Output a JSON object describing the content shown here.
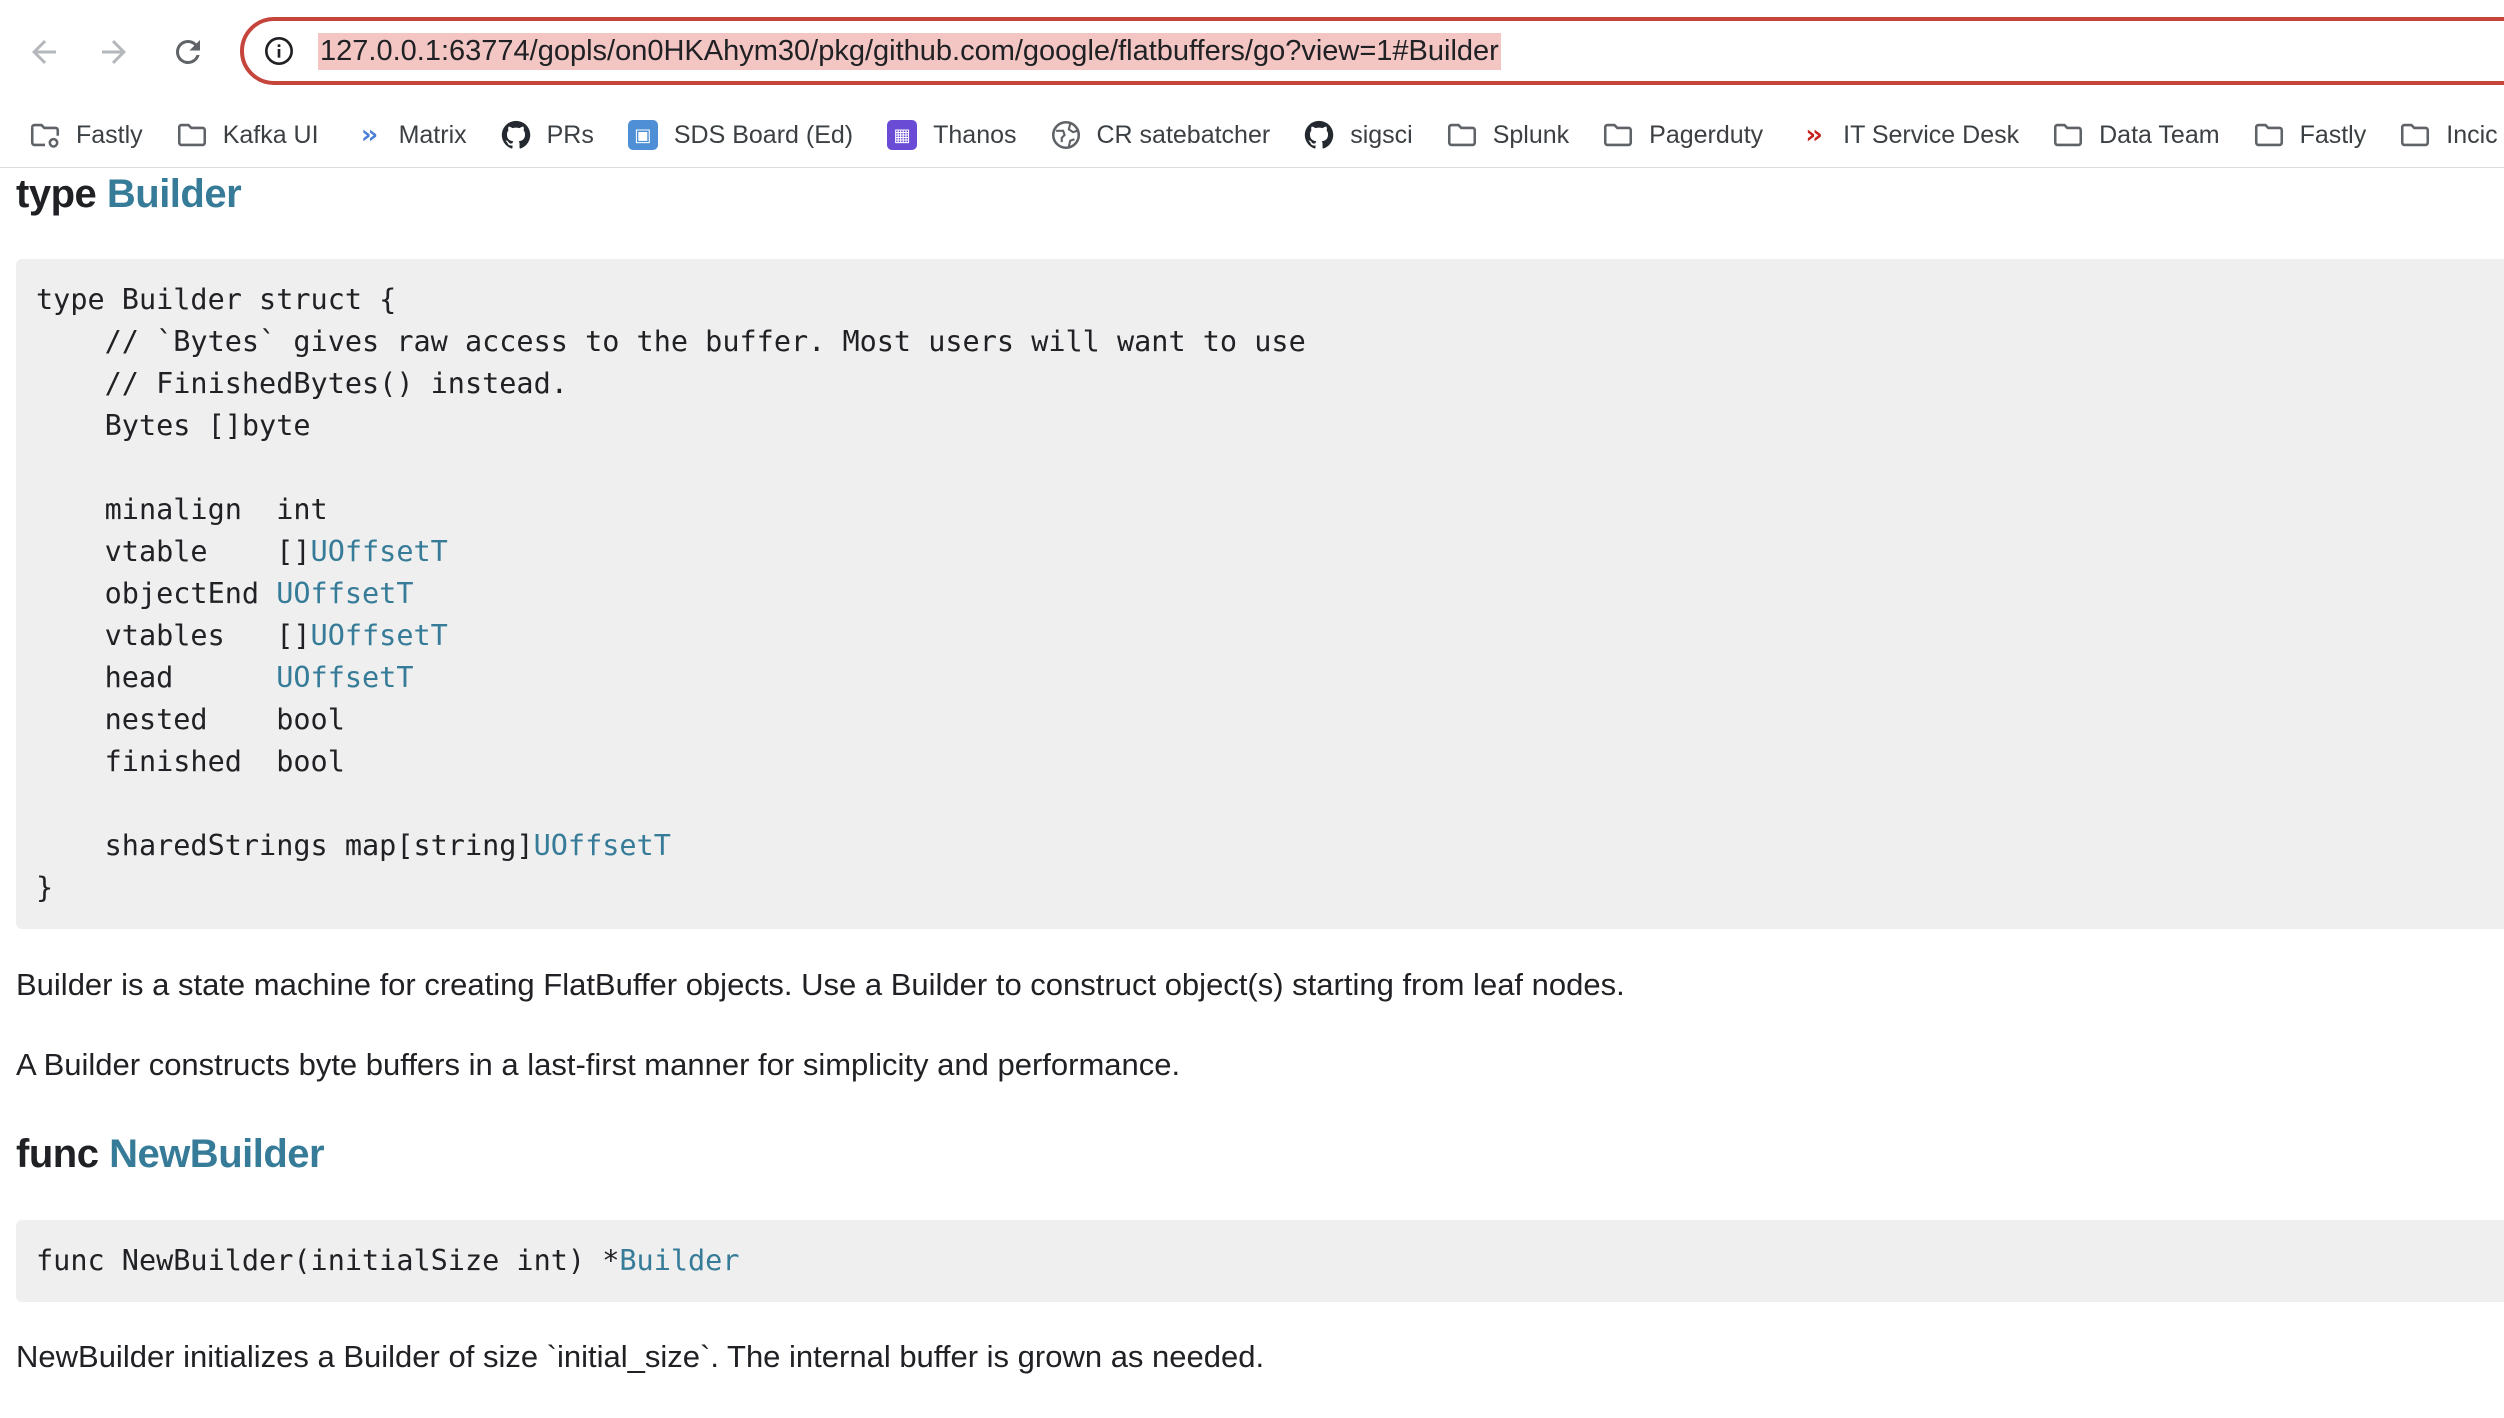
{
  "browser": {
    "url": "127.0.0.1:63774/gopls/on0HKAhym30/pkg/github.com/google/flatbuffers/go?view=1#Builder",
    "bookmarks": [
      {
        "label": "Fastly",
        "icon": "folder-gear-icon"
      },
      {
        "label": "Kafka UI",
        "icon": "folder-icon"
      },
      {
        "label": "Matrix",
        "icon": "double-chevron-icon",
        "color": "#4a7fd6"
      },
      {
        "label": "PRs",
        "icon": "github-icon"
      },
      {
        "label": "SDS Board (Ed)",
        "icon": "jira-board-icon",
        "color": "#4f8fd6"
      },
      {
        "label": "Thanos",
        "icon": "thanos-icon",
        "color": "#6a4bd6"
      },
      {
        "label": "CR satebatcher",
        "icon": "globe-icon"
      },
      {
        "label": "sigsci",
        "icon": "github-icon"
      },
      {
        "label": "Splunk",
        "icon": "folder-icon"
      },
      {
        "label": "Pagerduty",
        "icon": "folder-icon"
      },
      {
        "label": "IT Service Desk",
        "icon": "double-chevron-icon",
        "color": "#c5221f"
      },
      {
        "label": "Data Team",
        "icon": "folder-icon"
      },
      {
        "label": "Fastly",
        "icon": "folder-icon"
      },
      {
        "label": "Incic",
        "icon": "folder-icon"
      }
    ]
  },
  "doc": {
    "type_heading": {
      "keyword": "type",
      "name": "Builder"
    },
    "type_code": [
      [
        {
          "t": "type Builder struct {"
        }
      ],
      [
        {
          "t": "    // `Bytes` gives raw access to the buffer. Most users will want to use"
        }
      ],
      [
        {
          "t": "    // FinishedBytes() instead."
        }
      ],
      [
        {
          "t": "    Bytes []byte"
        }
      ],
      [
        {
          "t": ""
        }
      ],
      [
        {
          "t": "    minalign  int"
        }
      ],
      [
        {
          "t": "    vtable    []"
        },
        {
          "t": "UOffsetT",
          "link": true
        }
      ],
      [
        {
          "t": "    objectEnd "
        },
        {
          "t": "UOffsetT",
          "link": true
        }
      ],
      [
        {
          "t": "    vtables   []"
        },
        {
          "t": "UOffsetT",
          "link": true
        }
      ],
      [
        {
          "t": "    head      "
        },
        {
          "t": "UOffsetT",
          "link": true
        }
      ],
      [
        {
          "t": "    nested    bool"
        }
      ],
      [
        {
          "t": "    finished  bool"
        }
      ],
      [
        {
          "t": ""
        }
      ],
      [
        {
          "t": "    sharedStrings map[string]"
        },
        {
          "t": "UOffsetT",
          "link": true
        }
      ],
      [
        {
          "t": "}"
        }
      ]
    ],
    "type_paragraphs": [
      "Builder is a state machine for creating FlatBuffer objects. Use a Builder to construct object(s) starting from leaf nodes.",
      "A Builder constructs byte buffers in a last-first manner for simplicity and performance."
    ],
    "func_heading": {
      "keyword": "func",
      "name": "NewBuilder"
    },
    "func_code": [
      [
        {
          "t": "func NewBuilder(initialSize int) *"
        },
        {
          "t": "Builder",
          "link": true
        }
      ]
    ],
    "func_paragraph": "NewBuilder initializes a Builder of size `initial_size`. The internal buffer is grown as needed."
  },
  "colors": {
    "link": "#367b98",
    "code_bg": "#efefef",
    "omnibox_border": "#c5443b",
    "url_highlight": "#f3c6c3"
  }
}
